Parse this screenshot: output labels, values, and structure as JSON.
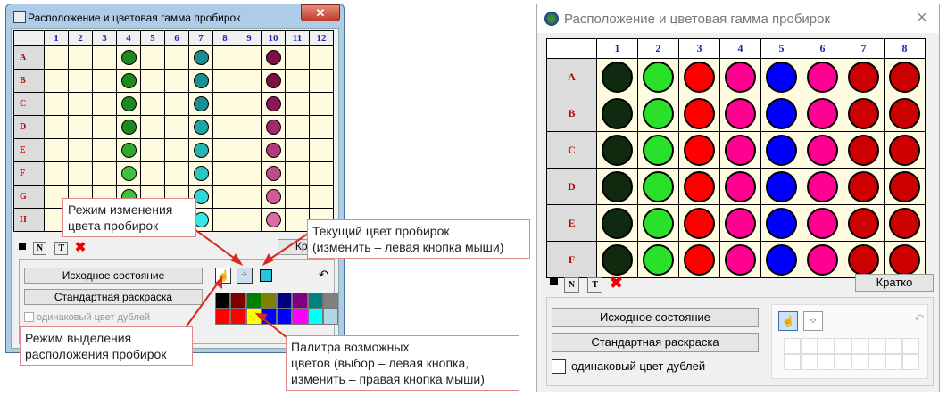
{
  "left": {
    "title": "Расположение и цветовая гамма пробирок",
    "close": "✕",
    "cols": [
      "1",
      "2",
      "3",
      "4",
      "5",
      "6",
      "7",
      "8",
      "9",
      "10",
      "11",
      "12"
    ],
    "rows": [
      "A",
      "B",
      "C",
      "D",
      "E",
      "F",
      "G",
      "H"
    ],
    "col4": [
      "#1e8a1e",
      "#1e8a1e",
      "#1e8a1e",
      "#1e8a1e",
      "#2fa82f",
      "#3cc23c",
      "#3cc23c",
      "#44d044"
    ],
    "col7": [
      "#1a8f8f",
      "#1a8f8f",
      "#1a8f8f",
      "#22a5a5",
      "#26b3b3",
      "#2cc4c4",
      "#32d6d6",
      "#38e6e6"
    ],
    "col10": [
      "#7a1045",
      "#7a1045",
      "#8a1858",
      "#a02a6a",
      "#b03a7a",
      "#c04a8a",
      "#d25a9a",
      "#e06aa8"
    ],
    "btn_initial": "Исходное состояние",
    "btn_standard": "Стандартная раскраска",
    "chk_label": "одинаковый цвет дублей",
    "brief": "Кра",
    "tool_n": "N",
    "tool_t": "T",
    "current_color": "#26c6da",
    "palette": [
      "#000000",
      "#800000",
      "#008000",
      "#808000",
      "#000080",
      "#800080",
      "#008080",
      "#808080",
      "#ff0000",
      "#ff0000",
      "#ffff00",
      "#0000ff",
      "#0000ff",
      "#ff00ff",
      "#00ffff",
      "#add8e6"
    ]
  },
  "callouts": {
    "mode_change": "Режим изменения\nцвета пробирок",
    "current_color": "Текущий цвет пробирок\n(изменить – левая кнопка мыши)",
    "mode_select": "Режим выделения\nрасположения пробирок",
    "palette": "Палитра возможных\nцветов (выбор – левая кнопка,\nизменить – правая кнопка мыши)"
  },
  "right": {
    "title": "Расположение и цветовая гамма пробирок",
    "close": "×",
    "cols": [
      "1",
      "2",
      "3",
      "4",
      "5",
      "6",
      "7",
      "8"
    ],
    "rows": [
      "A",
      "B",
      "C",
      "D",
      "E",
      "F"
    ],
    "col_colors": [
      "#0f2a0f",
      "#2be02b",
      "#ff0000",
      "#ff0090",
      "#0000ff",
      "#ff0090",
      "#cc0000",
      "#cc0000"
    ],
    "tool_n": "N",
    "tool_t": "T",
    "brief": "Кратко",
    "btn_initial": "Исходное состояние",
    "btn_standard": "Стандартная раскраска",
    "chk_label": "одинаковый цвет дублей"
  }
}
